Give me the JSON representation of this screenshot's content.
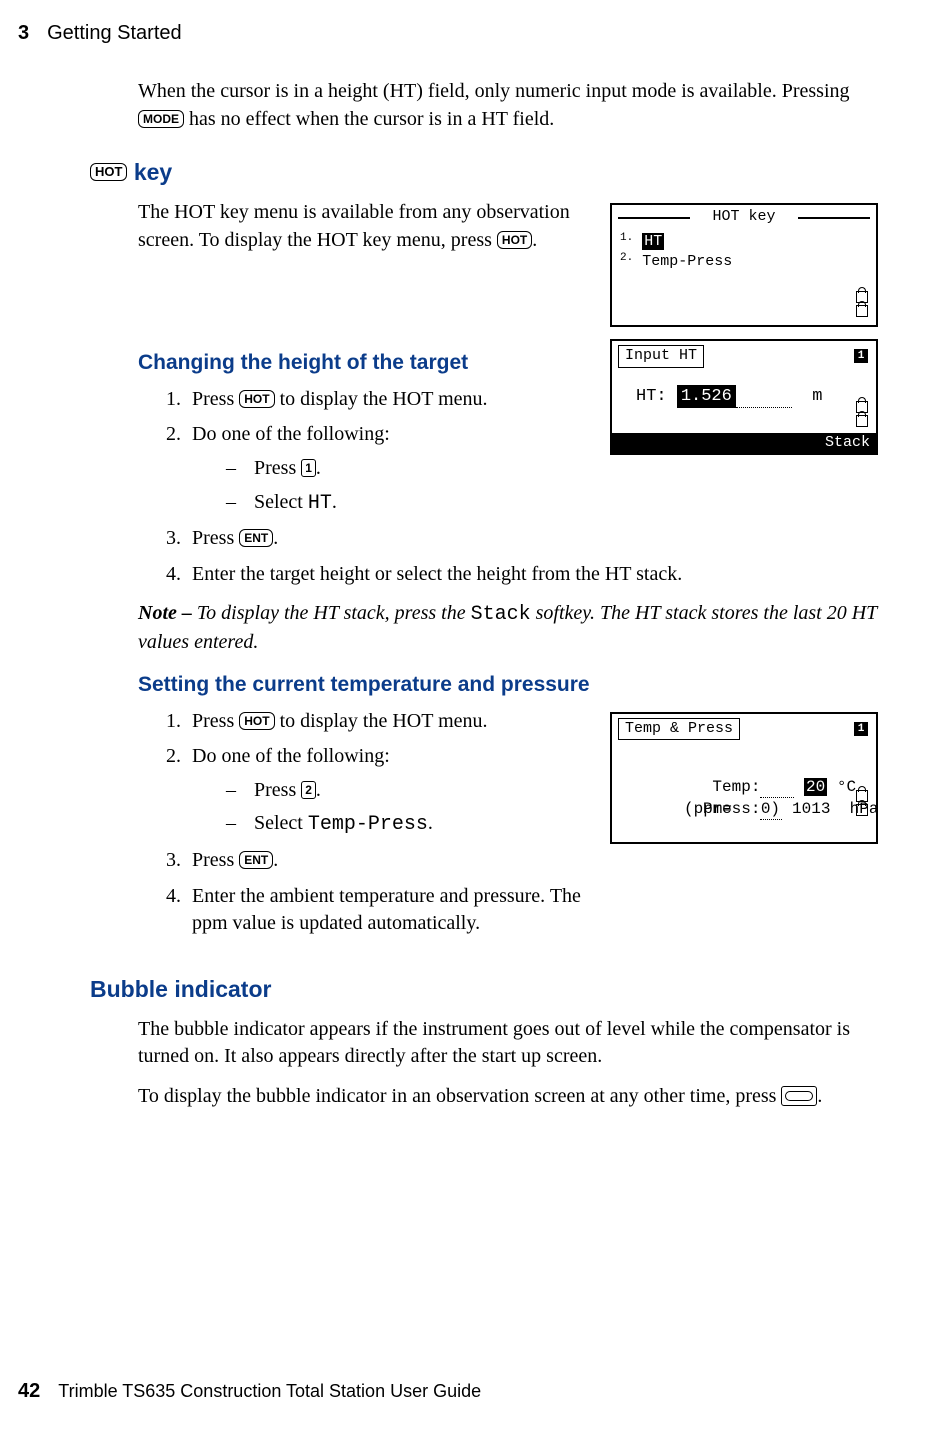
{
  "header": {
    "chapter_number": "3",
    "chapter_title": "Getting Started"
  },
  "footer": {
    "page_number": "42",
    "book_title": "Trimble TS635 Construction Total Station User Guide"
  },
  "intro": {
    "p1a": "When the cursor is in a height (HT) field, only numeric input mode is available. Pressing ",
    "p1key": "MODE",
    "p1b": " has no effect when the cursor is in a HT field."
  },
  "sec_hot": {
    "key_label": "HOT",
    "heading_text": " key",
    "p_a": "The HOT key menu is available from any observation screen. To display the HOT key menu, press ",
    "p_key": "HOT",
    "p_b": "."
  },
  "shot_hotkey": {
    "title": "HOT key",
    "row1_sup": "1.",
    "row1_sel": "HT",
    "row2": "2. Temp-Press"
  },
  "sub_change_ht": {
    "heading": "Changing the height of the target",
    "step1_a": "Press ",
    "step1_key": "HOT",
    "step1_b": " to display the HOT menu.",
    "step2": "Do one of the following:",
    "step2a_a": "Press ",
    "step2a_key": "1",
    "step2a_b": ".",
    "step2b_a": "Select ",
    "step2b_lcd": "HT",
    "step2b_b": ".",
    "step3_a": "Press ",
    "step3_key": "ENT",
    "step3_b": ".",
    "step4": "Enter the target height or select the height from the HT stack.",
    "note_a": "Note – ",
    "note_b": "To display the HT stack, press the ",
    "note_lcd": "Stack",
    "note_c": " softkey. The HT stack stores the last 20 HT values entered."
  },
  "shot_input_ht": {
    "tab": "Input HT",
    "label": "HT:",
    "value": "1.526",
    "unit": "m",
    "softkey": "Stack",
    "num_badge": "1"
  },
  "sub_temp": {
    "heading": "Setting the current temperature and pressure",
    "step1_a": "Press ",
    "step1_key": "HOT",
    "step1_b": " to display the HOT menu.",
    "step2": "Do one of the following:",
    "step2a_a": "Press ",
    "step2a_key": "2",
    "step2a_b": ".",
    "step2b_a": "Select ",
    "step2b_lcd": "Temp-Press",
    "step2b_b": ".",
    "step3_a": "Press ",
    "step3_key": "ENT",
    "step3_b": ".",
    "step4": "Enter the ambient temperature and pressure. The ppm value is updated automatically."
  },
  "shot_temp": {
    "tab": "Temp & Press",
    "num_badge": "1",
    "row1_label": "Temp:",
    "row1_val": "20",
    "row1_unit": "°C",
    "row2_label": "Press:",
    "row2_val": "1013",
    "row2_unit": "hPa",
    "row3": "(ppm=   0)"
  },
  "sec_bubble": {
    "heading": "Bubble indicator",
    "p1": "The bubble indicator appears if the instrument goes out of level while the compensator is turned on. It also appears directly after the start up screen.",
    "p2_a": "To display the bubble indicator in an observation screen at any other time, press ",
    "p2_b": "."
  }
}
